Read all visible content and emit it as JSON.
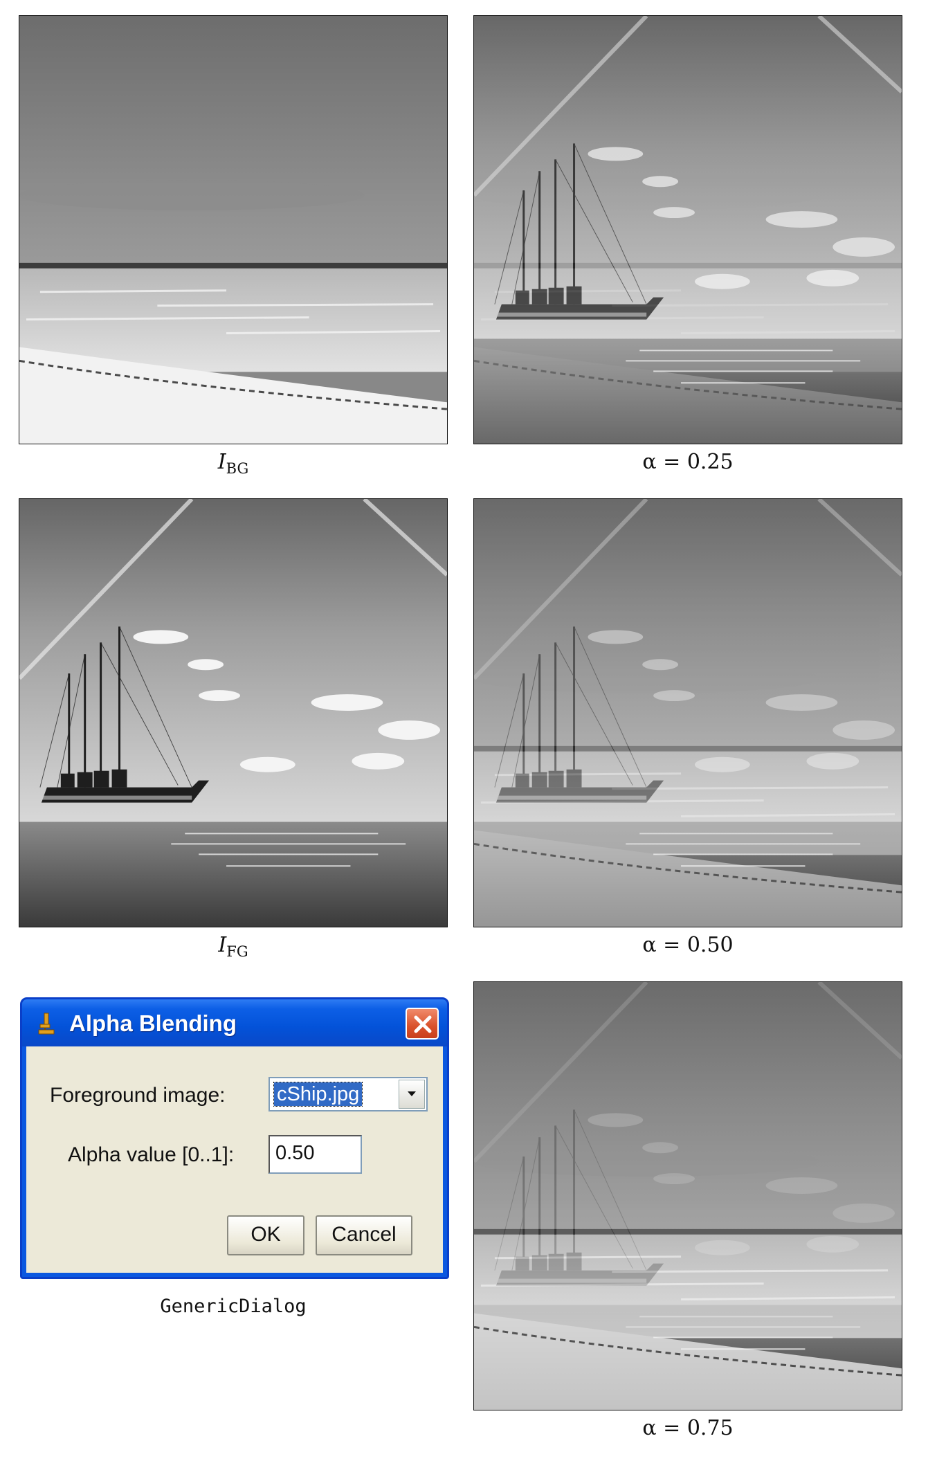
{
  "captions": {
    "bg": {
      "main": "I",
      "sub": "BG"
    },
    "fg": {
      "main": "I",
      "sub": "FG"
    },
    "alpha025": "α = 0.25",
    "alpha050": "α = 0.50",
    "alpha075": "α = 0.75",
    "dialog": "GenericDialog"
  },
  "dialog": {
    "title": "Alpha Blending",
    "foreground_label": "Foreground image:",
    "foreground_value": "cShip.jpg",
    "alpha_label": "Alpha value [0..1]:",
    "alpha_value": "0.50",
    "ok_label": "OK",
    "cancel_label": "Cancel"
  },
  "icons": {
    "title": "microscope-icon",
    "close": "close-icon",
    "dropdown": "chevron-down-icon"
  },
  "colors": {
    "title_bar": "#0352d8",
    "dialog_body": "#ece9d8",
    "selection": "#316ac5",
    "close_button": "#d9502a"
  },
  "blend": {
    "panel_alpha025": 0.25,
    "panel_alpha050": 0.5,
    "panel_alpha075": 0.75
  }
}
